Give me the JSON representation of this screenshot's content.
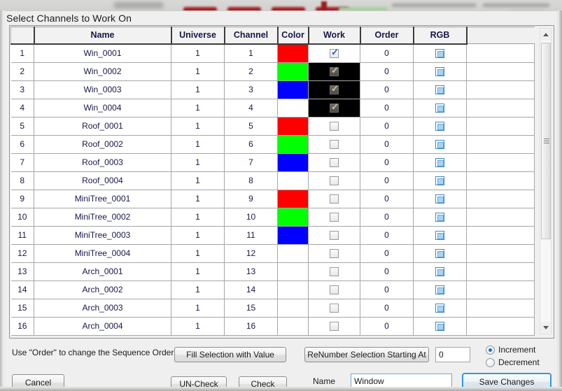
{
  "window": {
    "title": "Select Channels to Work On"
  },
  "grid": {
    "columns": [
      "",
      "Name",
      "Universe",
      "Channel",
      "Color",
      "Work",
      "Order",
      "RGB"
    ],
    "rows": [
      {
        "num": "1",
        "name": "Win_0001",
        "universe": "1",
        "channel": "1",
        "color": "#ff0000",
        "work_checked": true,
        "selected": false,
        "order": "0",
        "rgb_checked": false
      },
      {
        "num": "2",
        "name": "Win_0002",
        "universe": "1",
        "channel": "2",
        "color": "#00ff00",
        "work_checked": true,
        "selected": true,
        "order": "0",
        "rgb_checked": false
      },
      {
        "num": "3",
        "name": "Win_0003",
        "universe": "1",
        "channel": "3",
        "color": "#0000ff",
        "work_checked": true,
        "selected": true,
        "order": "0",
        "rgb_checked": false
      },
      {
        "num": "4",
        "name": "Win_0004",
        "universe": "1",
        "channel": "4",
        "color": "#ffffff",
        "work_checked": true,
        "selected": true,
        "order": "0",
        "rgb_checked": false
      },
      {
        "num": "5",
        "name": "Roof_0001",
        "universe": "1",
        "channel": "5",
        "color": "#ff0000",
        "work_checked": false,
        "selected": false,
        "order": "0",
        "rgb_checked": false
      },
      {
        "num": "6",
        "name": "Roof_0002",
        "universe": "1",
        "channel": "6",
        "color": "#00ff00",
        "work_checked": false,
        "selected": false,
        "order": "0",
        "rgb_checked": false
      },
      {
        "num": "7",
        "name": "Roof_0003",
        "universe": "1",
        "channel": "7",
        "color": "#0000ff",
        "work_checked": false,
        "selected": false,
        "order": "0",
        "rgb_checked": false
      },
      {
        "num": "8",
        "name": "Roof_0004",
        "universe": "1",
        "channel": "8",
        "color": "#ffffff",
        "work_checked": false,
        "selected": false,
        "order": "0",
        "rgb_checked": false
      },
      {
        "num": "9",
        "name": "MiniTree_0001",
        "universe": "1",
        "channel": "9",
        "color": "#ff0000",
        "work_checked": false,
        "selected": false,
        "order": "0",
        "rgb_checked": false
      },
      {
        "num": "10",
        "name": "MiniTree_0002",
        "universe": "1",
        "channel": "10",
        "color": "#00ff00",
        "work_checked": false,
        "selected": false,
        "order": "0",
        "rgb_checked": false
      },
      {
        "num": "11",
        "name": "MiniTree_0003",
        "universe": "1",
        "channel": "11",
        "color": "#0000ff",
        "work_checked": false,
        "selected": false,
        "order": "0",
        "rgb_checked": false
      },
      {
        "num": "12",
        "name": "MiniTree_0004",
        "universe": "1",
        "channel": "12",
        "color": "#ffffff",
        "work_checked": false,
        "selected": false,
        "order": "0",
        "rgb_checked": false
      },
      {
        "num": "13",
        "name": "Arch_0001",
        "universe": "1",
        "channel": "13",
        "color": "#ffffff",
        "work_checked": false,
        "selected": false,
        "order": "0",
        "rgb_checked": false
      },
      {
        "num": "14",
        "name": "Arch_0002",
        "universe": "1",
        "channel": "14",
        "color": "#ffffff",
        "work_checked": false,
        "selected": false,
        "order": "0",
        "rgb_checked": false
      },
      {
        "num": "15",
        "name": "Arch_0003",
        "universe": "1",
        "channel": "15",
        "color": "#ffffff",
        "work_checked": false,
        "selected": false,
        "order": "0",
        "rgb_checked": false
      },
      {
        "num": "16",
        "name": "Arch_0004",
        "universe": "1",
        "channel": "16",
        "color": "#ffffff",
        "work_checked": false,
        "selected": false,
        "order": "0",
        "rgb_checked": false
      }
    ]
  },
  "scrollbar": {
    "up_icon": "scroll-up-arrow",
    "down_icon": "scroll-down-arrow"
  },
  "footer": {
    "hint": "Use \"Order\" to change the Sequence Order",
    "fill_selection_label": "Fill Selection with Value",
    "renumber_label": "ReNumber Selection Starting At",
    "renumber_value": "0",
    "cancel_label": "Cancel",
    "uncheck_label": "UN-Check",
    "check_label": "Check",
    "name_label": "Name",
    "name_value": "Window",
    "save_label": "Save Changes",
    "increment_label": "Increment",
    "decrement_label": "Decrement",
    "direction_selected": "Increment"
  },
  "colors": {
    "accent": "#2e9ad8",
    "red": "#ff0000",
    "green": "#00ff00",
    "blue": "#0000ff",
    "selection": "#000000"
  }
}
